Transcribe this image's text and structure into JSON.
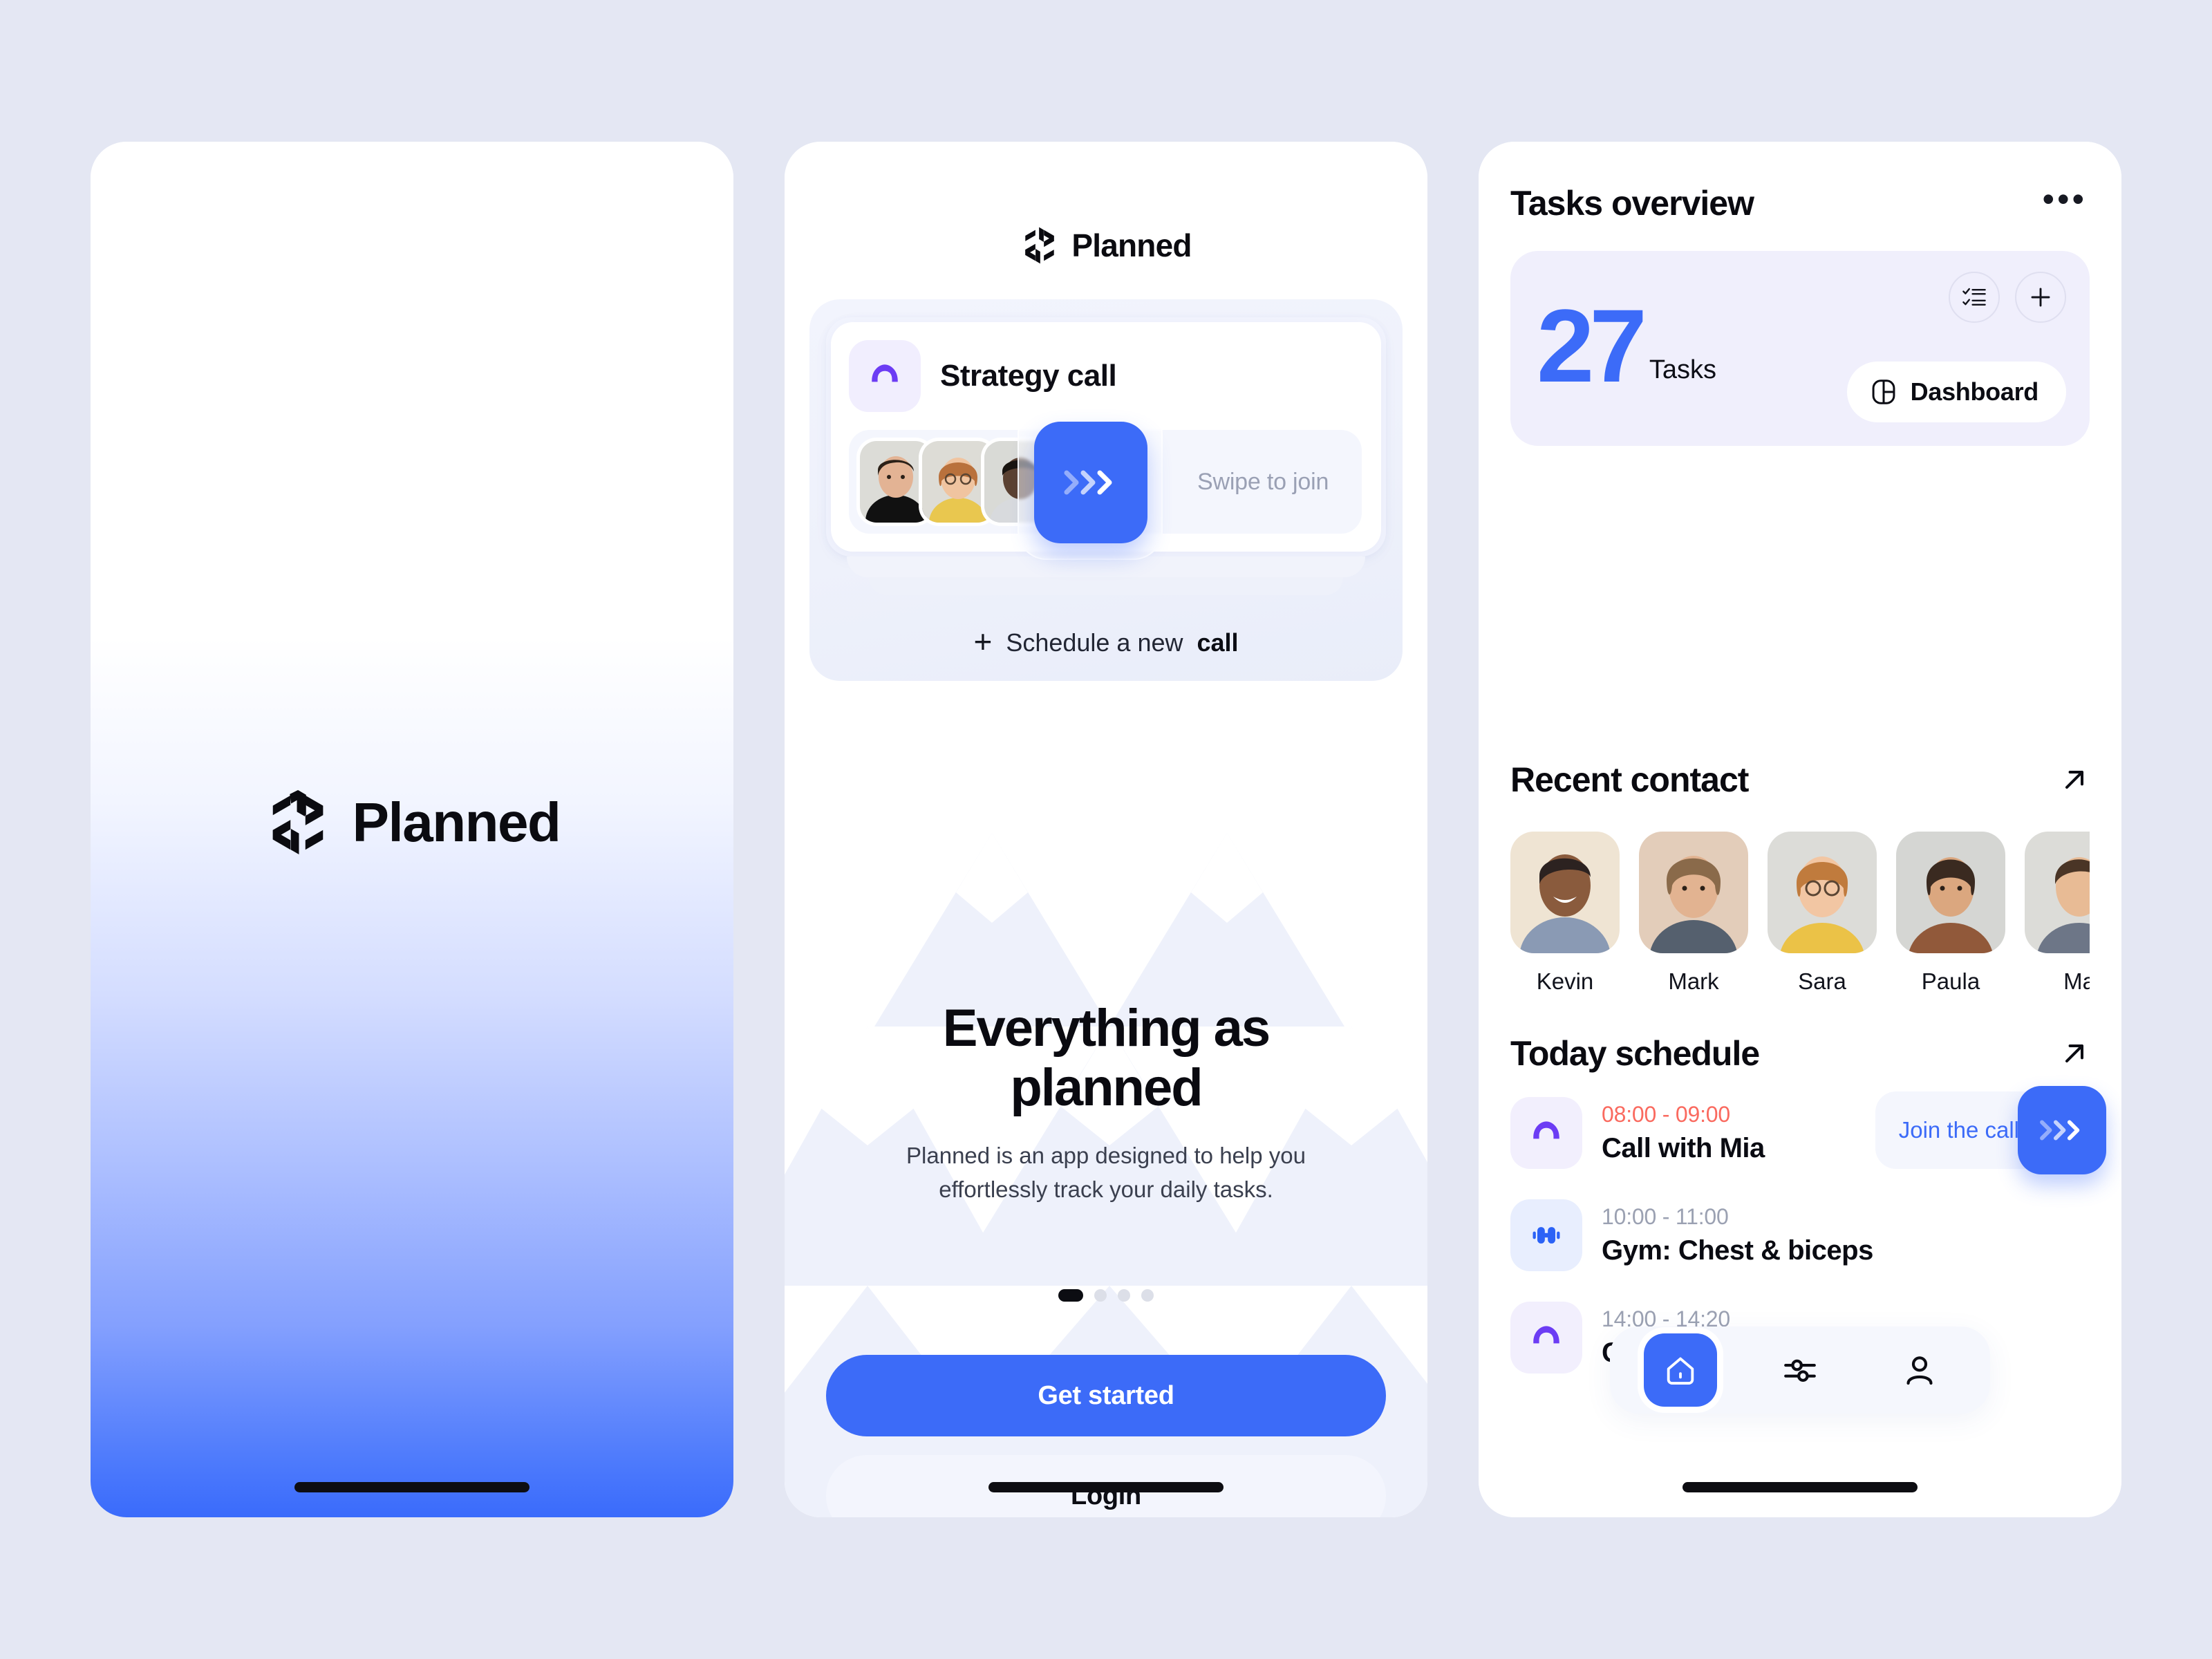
{
  "theme": {
    "accent_blue": "#3c6bf8",
    "accent_purple": "#6c3cf4",
    "alert_red": "#fa6a5f",
    "page_bg": "#e4e7f3",
    "tasks_card_bg": "#f0effc"
  },
  "screens": {
    "splash": {
      "name": "splash-screen",
      "brand": "Planned",
      "logo_icon": "planned-logo-icon"
    },
    "onboarding": {
      "name": "onboarding-screen",
      "brand": "Planned",
      "logo_icon": "planned-logo-icon",
      "call_card": {
        "icon": "phone-call-icon",
        "title": "Strategy call",
        "swipe_label": "Swipe to join",
        "swipe_knob_icon": "chevrons-right-icon",
        "participants": [
          "participant-1",
          "participant-2",
          "participant-3"
        ]
      },
      "schedule_link": {
        "plus_icon": "plus-icon",
        "text_normal": "Schedule a new ",
        "text_bold": "call"
      },
      "hero": {
        "title": "Everything as planned",
        "description": "Planned is an app designed to help you effortlessly track your daily tasks."
      },
      "pagination": {
        "total": 4,
        "active_index": 0
      },
      "primary_button": "Get started",
      "secondary_button": "Login"
    },
    "dashboard": {
      "name": "dashboard-screen",
      "tasks_overview": {
        "title": "Tasks overview",
        "more_icon": "more-horizontal-icon",
        "count": "27",
        "count_label": "Tasks",
        "checklist_icon": "checklist-icon",
        "add_icon": "plus-icon",
        "dashboard_button": {
          "icon": "layout-panel-icon",
          "label": "Dashboard"
        }
      },
      "recent_contact": {
        "title": "Recent contact",
        "expand_icon": "arrow-up-right-icon",
        "contacts": [
          {
            "name": "Kevin",
            "avatar": "avatar-kevin"
          },
          {
            "name": "Mark",
            "avatar": "avatar-mark"
          },
          {
            "name": "Sara",
            "avatar": "avatar-sara"
          },
          {
            "name": "Paula",
            "avatar": "avatar-paula"
          },
          {
            "name": "Ma",
            "avatar": "avatar-max"
          }
        ]
      },
      "today_schedule": {
        "title": "Today schedule",
        "expand_icon": "arrow-up-right-icon",
        "events": [
          {
            "time": "08:00 - 09:00",
            "title": "Call with Mia",
            "icon": "phone-call-icon",
            "icon_style": "purple",
            "live": true,
            "action_label": "Join the call",
            "action_icon": "chevrons-right-icon"
          },
          {
            "time": "10:00 - 11:00",
            "title": "Gym: Chest & biceps",
            "icon": "dumbbell-icon",
            "icon_style": "blue",
            "live": false
          },
          {
            "time": "14:00 - 14:20",
            "title": "Call with Mark",
            "icon": "phone-call-icon",
            "icon_style": "purple",
            "live": false
          }
        ]
      },
      "tabbar": [
        {
          "icon": "home-icon",
          "active": true
        },
        {
          "icon": "sliders-icon",
          "active": false
        },
        {
          "icon": "user-icon",
          "active": false
        }
      ]
    }
  }
}
